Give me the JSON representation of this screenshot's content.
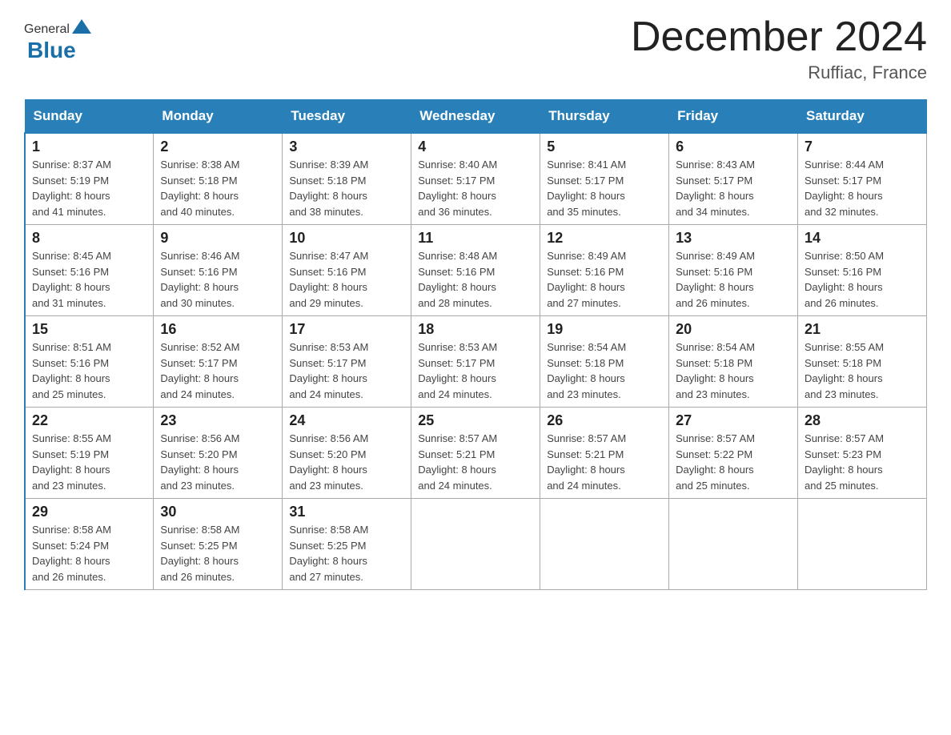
{
  "header": {
    "title": "December 2024",
    "location": "Ruffiac, France",
    "logo_general": "General",
    "logo_blue": "Blue"
  },
  "days_of_week": [
    "Sunday",
    "Monday",
    "Tuesday",
    "Wednesday",
    "Thursday",
    "Friday",
    "Saturday"
  ],
  "weeks": [
    [
      {
        "day": "1",
        "sunrise": "8:37 AM",
        "sunset": "5:19 PM",
        "daylight": "8 hours and 41 minutes."
      },
      {
        "day": "2",
        "sunrise": "8:38 AM",
        "sunset": "5:18 PM",
        "daylight": "8 hours and 40 minutes."
      },
      {
        "day": "3",
        "sunrise": "8:39 AM",
        "sunset": "5:18 PM",
        "daylight": "8 hours and 38 minutes."
      },
      {
        "day": "4",
        "sunrise": "8:40 AM",
        "sunset": "5:17 PM",
        "daylight": "8 hours and 36 minutes."
      },
      {
        "day": "5",
        "sunrise": "8:41 AM",
        "sunset": "5:17 PM",
        "daylight": "8 hours and 35 minutes."
      },
      {
        "day": "6",
        "sunrise": "8:43 AM",
        "sunset": "5:17 PM",
        "daylight": "8 hours and 34 minutes."
      },
      {
        "day": "7",
        "sunrise": "8:44 AM",
        "sunset": "5:17 PM",
        "daylight": "8 hours and 32 minutes."
      }
    ],
    [
      {
        "day": "8",
        "sunrise": "8:45 AM",
        "sunset": "5:16 PM",
        "daylight": "8 hours and 31 minutes."
      },
      {
        "day": "9",
        "sunrise": "8:46 AM",
        "sunset": "5:16 PM",
        "daylight": "8 hours and 30 minutes."
      },
      {
        "day": "10",
        "sunrise": "8:47 AM",
        "sunset": "5:16 PM",
        "daylight": "8 hours and 29 minutes."
      },
      {
        "day": "11",
        "sunrise": "8:48 AM",
        "sunset": "5:16 PM",
        "daylight": "8 hours and 28 minutes."
      },
      {
        "day": "12",
        "sunrise": "8:49 AM",
        "sunset": "5:16 PM",
        "daylight": "8 hours and 27 minutes."
      },
      {
        "day": "13",
        "sunrise": "8:49 AM",
        "sunset": "5:16 PM",
        "daylight": "8 hours and 26 minutes."
      },
      {
        "day": "14",
        "sunrise": "8:50 AM",
        "sunset": "5:16 PM",
        "daylight": "8 hours and 26 minutes."
      }
    ],
    [
      {
        "day": "15",
        "sunrise": "8:51 AM",
        "sunset": "5:16 PM",
        "daylight": "8 hours and 25 minutes."
      },
      {
        "day": "16",
        "sunrise": "8:52 AM",
        "sunset": "5:17 PM",
        "daylight": "8 hours and 24 minutes."
      },
      {
        "day": "17",
        "sunrise": "8:53 AM",
        "sunset": "5:17 PM",
        "daylight": "8 hours and 24 minutes."
      },
      {
        "day": "18",
        "sunrise": "8:53 AM",
        "sunset": "5:17 PM",
        "daylight": "8 hours and 24 minutes."
      },
      {
        "day": "19",
        "sunrise": "8:54 AM",
        "sunset": "5:18 PM",
        "daylight": "8 hours and 23 minutes."
      },
      {
        "day": "20",
        "sunrise": "8:54 AM",
        "sunset": "5:18 PM",
        "daylight": "8 hours and 23 minutes."
      },
      {
        "day": "21",
        "sunrise": "8:55 AM",
        "sunset": "5:18 PM",
        "daylight": "8 hours and 23 minutes."
      }
    ],
    [
      {
        "day": "22",
        "sunrise": "8:55 AM",
        "sunset": "5:19 PM",
        "daylight": "8 hours and 23 minutes."
      },
      {
        "day": "23",
        "sunrise": "8:56 AM",
        "sunset": "5:20 PM",
        "daylight": "8 hours and 23 minutes."
      },
      {
        "day": "24",
        "sunrise": "8:56 AM",
        "sunset": "5:20 PM",
        "daylight": "8 hours and 23 minutes."
      },
      {
        "day": "25",
        "sunrise": "8:57 AM",
        "sunset": "5:21 PM",
        "daylight": "8 hours and 24 minutes."
      },
      {
        "day": "26",
        "sunrise": "8:57 AM",
        "sunset": "5:21 PM",
        "daylight": "8 hours and 24 minutes."
      },
      {
        "day": "27",
        "sunrise": "8:57 AM",
        "sunset": "5:22 PM",
        "daylight": "8 hours and 25 minutes."
      },
      {
        "day": "28",
        "sunrise": "8:57 AM",
        "sunset": "5:23 PM",
        "daylight": "8 hours and 25 minutes."
      }
    ],
    [
      {
        "day": "29",
        "sunrise": "8:58 AM",
        "sunset": "5:24 PM",
        "daylight": "8 hours and 26 minutes."
      },
      {
        "day": "30",
        "sunrise": "8:58 AM",
        "sunset": "5:25 PM",
        "daylight": "8 hours and 26 minutes."
      },
      {
        "day": "31",
        "sunrise": "8:58 AM",
        "sunset": "5:25 PM",
        "daylight": "8 hours and 27 minutes."
      },
      null,
      null,
      null,
      null
    ]
  ],
  "labels": {
    "sunrise": "Sunrise:",
    "sunset": "Sunset:",
    "daylight": "Daylight:"
  }
}
